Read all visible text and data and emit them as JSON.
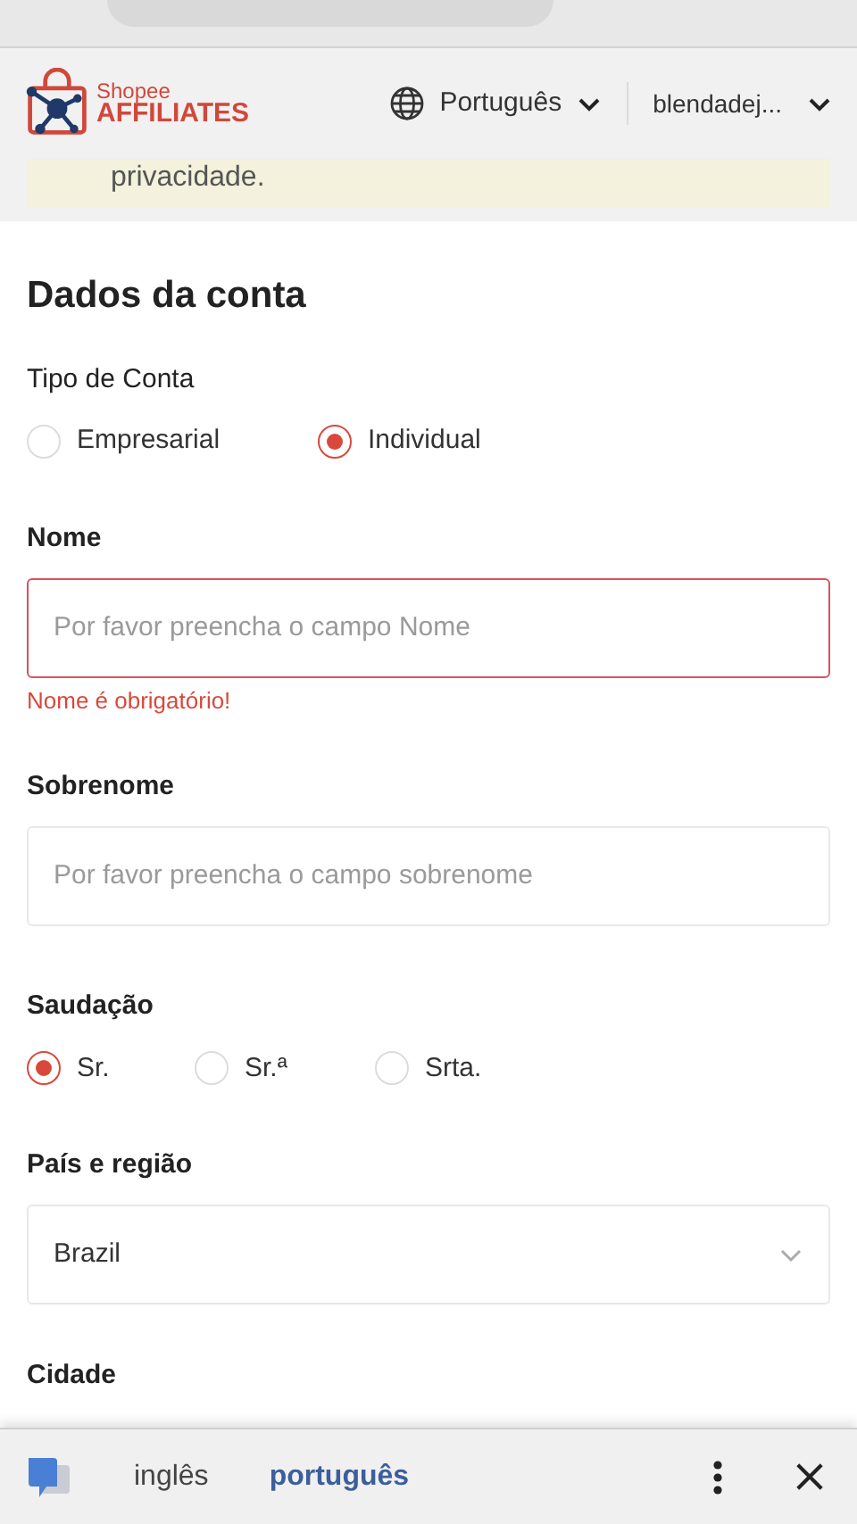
{
  "header": {
    "logo": {
      "line_1": "Shopee",
      "line_2": "AFFILIATES"
    },
    "language": "Português",
    "account": "blendadej..."
  },
  "notice": {
    "text": "privacidade."
  },
  "title": "Dados da conta",
  "account_type": {
    "label": "Tipo de Conta",
    "options": [
      {
        "label": "Empresarial",
        "selected": false
      },
      {
        "label": "Individual",
        "selected": true
      }
    ]
  },
  "first_name": {
    "label": "Nome",
    "placeholder": "Por favor preencha o campo Nome",
    "invalid": true,
    "error": "Nome é obrigatório!"
  },
  "last_name": {
    "label": "Sobrenome",
    "placeholder": "Por favor preencha o campo sobrenome",
    "invalid": false
  },
  "salutation": {
    "label": "Saudação",
    "options": [
      {
        "label": "Sr.",
        "selected": true
      },
      {
        "label": "Sr.ª",
        "selected": false
      },
      {
        "label": "Srta.",
        "selected": false
      }
    ]
  },
  "country": {
    "label": "País e região",
    "value": "Brazil"
  },
  "city": {
    "label": "Cidade"
  },
  "translate_bar": {
    "languages": [
      {
        "label": "inglês",
        "selected": false
      },
      {
        "label": "português",
        "selected": true
      }
    ]
  }
}
